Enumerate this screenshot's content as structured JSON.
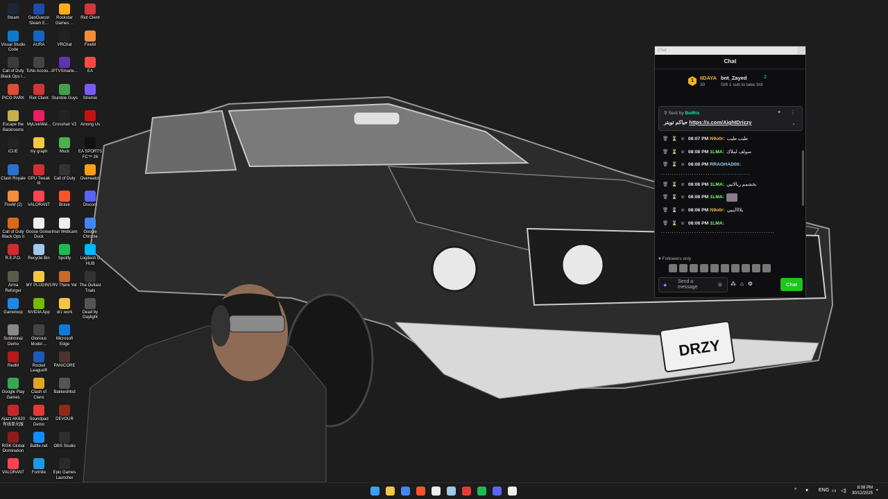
{
  "desktop": {
    "icons": [
      {
        "label": "Steam",
        "color": "#1b2838"
      },
      {
        "label": "Visual Studio Code",
        "color": "#0a7acc"
      },
      {
        "label": "Call of Duty Black Ops I...",
        "color": "#3b3b3b"
      },
      {
        "label": "PICO PARK",
        "color": "#e04a3a"
      },
      {
        "label": "Escape the Backrooms",
        "color": "#c7b14a"
      },
      {
        "label": "iCUE",
        "color": "#222"
      },
      {
        "label": "Clash Royale",
        "color": "#2b6fd1"
      },
      {
        "label": "FiveM (2)",
        "color": "#f18d3b"
      },
      {
        "label": "Call of Duty Black Ops II",
        "color": "#d86a1a"
      },
      {
        "label": "R.E.P.O.",
        "color": "#d12b2b"
      },
      {
        "label": "Arma Reforger",
        "color": "#5b5b4a"
      },
      {
        "label": "Gameloop",
        "color": "#1e88e5"
      },
      {
        "label": "Subliminal Demo",
        "color": "#888"
      },
      {
        "label": "RedM",
        "color": "#b51a1a"
      },
      {
        "label": "Google Play Games",
        "color": "#34a853"
      },
      {
        "label": "Ajazz AK820 有线单光版",
        "color": "#c62828"
      },
      {
        "label": "RISK Global Domination",
        "color": "#8e1b1b"
      },
      {
        "label": "VALORANT",
        "color": "#fa4454"
      },
      {
        "label": "GeoGuessr Steam E...",
        "color": "#1f4aa8"
      },
      {
        "label": "AURA",
        "color": "#1565c0"
      },
      {
        "label": "TcNo Accou...",
        "color": "#444"
      },
      {
        "label": "Riot Client",
        "color": "#d13639"
      },
      {
        "label": "MyLiveWal...",
        "color": "#e91e63"
      },
      {
        "label": "my graph",
        "color": "#f2c744"
      },
      {
        "label": "GPU Tweak III",
        "color": "#d32f2f"
      },
      {
        "label": "VALORANT",
        "color": "#fa4454"
      },
      {
        "label": "Goose Goose Duck",
        "color": "#eeeeee"
      },
      {
        "label": "Recycle Bin",
        "color": "#9ec9e8"
      },
      {
        "label": "MY PLUGINS",
        "color": "#f2c744"
      },
      {
        "label": "NVIDIA App",
        "color": "#76b900"
      },
      {
        "label": "Glorious Model ...",
        "color": "#444"
      },
      {
        "label": "Rocket League®",
        "color": "#1e5ab4"
      },
      {
        "label": "Clash of Clans",
        "color": "#e0a526"
      },
      {
        "label": "Soundpad Demo",
        "color": "#e53935"
      },
      {
        "label": "Battle.net",
        "color": "#148eff"
      },
      {
        "label": "Fortnite",
        "color": "#1e9be6"
      },
      {
        "label": "Rockstar Games ...",
        "color": "#fcaf17"
      },
      {
        "label": "VRChat",
        "color": "#222"
      },
      {
        "label": "IPTVSmarte...",
        "color": "#5e35b1"
      },
      {
        "label": "Stumble Guys",
        "color": "#43a047"
      },
      {
        "label": "Crosshair V2",
        "color": "#222"
      },
      {
        "label": "Muck",
        "color": "#4caf50"
      },
      {
        "label": "Call of Duty",
        "color": "#333"
      },
      {
        "label": "Brave",
        "color": "#fb542b"
      },
      {
        "label": "Iriun Webcam",
        "color": "#eeeeee"
      },
      {
        "label": "Spotify",
        "color": "#1db954"
      },
      {
        "label": "RV There Yet",
        "color": "#c56b2c"
      },
      {
        "label": "drz work",
        "color": "#f2c744"
      },
      {
        "label": "Microsoft Edge",
        "color": "#0f7bd8"
      },
      {
        "label": "PANICORE",
        "color": "#4e342e"
      },
      {
        "label": "BakkesMod",
        "color": "#555"
      },
      {
        "label": "DEVOUR",
        "color": "#8d2a1a"
      },
      {
        "label": "OBS Studio",
        "color": "#302e31"
      },
      {
        "label": "Epic Games Launcher",
        "color": "#2a2a2a"
      },
      {
        "label": "Riot Client",
        "color": "#d13639"
      },
      {
        "label": "FiveM",
        "color": "#f18d3b"
      },
      {
        "label": "EA",
        "color": "#ff4747"
      },
      {
        "label": "Stremio",
        "color": "#7b5bf5"
      },
      {
        "label": "Among Us",
        "color": "#c51111"
      },
      {
        "label": "EA SPORTS FC™ 26",
        "color": "#111"
      },
      {
        "label": "Overwatch",
        "color": "#f99e1a"
      },
      {
        "label": "Discord",
        "color": "#5865f2"
      },
      {
        "label": "Google Chrome",
        "color": "#4285f4"
      },
      {
        "label": "Logitech G HUB",
        "color": "#00b8fc"
      },
      {
        "label": "The Outlast Trials",
        "color": "#333"
      },
      {
        "label": "Dead by Daylight",
        "color": "#555"
      }
    ]
  },
  "wallpaper": {
    "plate_text": "DRZY"
  },
  "chat": {
    "window_title": "Chat",
    "header_title": "Chat",
    "gift_leader": {
      "rank": "1",
      "name": "IIDAYA",
      "count": "30"
    },
    "gift_second": {
      "name": "bnt_Zayed",
      "count": "2",
      "hint": "Gift 1 sub to take 3rd"
    },
    "pinned": {
      "sent_by_label": "Sent by",
      "bot_name": "BotRix",
      "message_prefix": "حياكم تويتر",
      "link": "https://x.com/AightDrizzy"
    },
    "messages": [
      {
        "time": "08:07 PM",
        "user": "N9o0r:",
        "user_color": "#ffb84d",
        "text": "طيب طيب",
        "emote": false,
        "cont": ""
      },
      {
        "time": "08:08 PM",
        "user": "1LMA:",
        "user_color": "#7cff6b",
        "text": "سولف لملاك",
        "emote": false,
        "cont": ""
      },
      {
        "time": "08:08 PM",
        "user": "RRAGHAD00:",
        "user_color": "#9ad5ff",
        "text": "",
        "emote": false,
        "cont": "٠٠٠٠٠٠٠٠٠٠٠٠٠٠٠٠٠٠٠٠٠٠٠٠٠٠٠٠٠٠٠٠٠٠٠٠٠٠٠٠"
      },
      {
        "time": "08:08 PM",
        "user": "1LMA:",
        "user_color": "#7cff6b",
        "text": "بخشمم ريالاتيي",
        "emote": false,
        "cont": ""
      },
      {
        "time": "08:08 PM",
        "user": "1LMA:",
        "user_color": "#7cff6b",
        "text": "",
        "emote": true,
        "cont": ""
      },
      {
        "time": "08:08 PM",
        "user": "N9o0r:",
        "user_color": "#ffb84d",
        "text": "يلاااايييي",
        "emote": false,
        "cont": ""
      },
      {
        "time": "08:08 PM",
        "user": "1LMA:",
        "user_color": "#7cff6b",
        "text": "",
        "emote": false,
        "cont": "٠٠٠٠٠٠٠٠٠٠٠٠٠٠٠٠٠٠٠٠٠٠٠٠٠٠٠٠٠٠٠٠٠٠٠٠٠٠٠٠٠٠٠٠٠٠٠٠٠٠٠"
      }
    ],
    "followers_only": "Followers only",
    "input_placeholder": "Send a message",
    "chat_button": "Chat"
  },
  "taskbar": {
    "apps": [
      {
        "name": "windows-start-icon",
        "color": "#3aa0ff"
      },
      {
        "name": "file-explorer-icon",
        "color": "#f2c744"
      },
      {
        "name": "chrome-icon",
        "color": "#4285f4"
      },
      {
        "name": "brave-icon",
        "color": "#fb542b"
      },
      {
        "name": "capcut-icon",
        "color": "#eeeeee"
      },
      {
        "name": "steam-icon",
        "color": "#9ec9e8"
      },
      {
        "name": "roblox-icon",
        "color": "#e53935"
      },
      {
        "name": "spotify-icon",
        "color": "#1db954"
      },
      {
        "name": "discord-icon",
        "color": "#5865f2"
      },
      {
        "name": "obs-icon",
        "color": "#eeeeee"
      }
    ],
    "language": "ENG",
    "time": "8:08 PM",
    "date": "30/12/2025"
  }
}
